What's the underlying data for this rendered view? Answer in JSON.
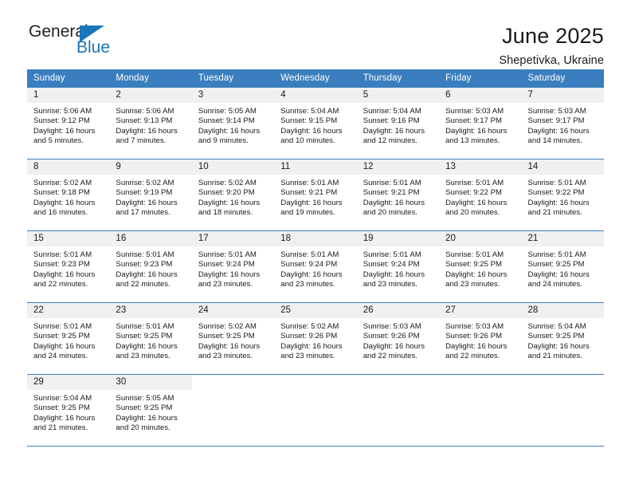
{
  "brand": {
    "name_top": "General",
    "name_bottom": "Blue",
    "accent_color": "#1b75bb"
  },
  "header": {
    "title": "June 2025",
    "subtitle": "Shepetivka, Ukraine"
  },
  "calendar": {
    "header_bg": "#3a7ebf",
    "header_text_color": "#ffffff",
    "daynum_bg": "#f0f0f0",
    "weekdays": [
      "Sunday",
      "Monday",
      "Tuesday",
      "Wednesday",
      "Thursday",
      "Friday",
      "Saturday"
    ],
    "weeks": [
      [
        {
          "day": "1",
          "sunrise": "Sunrise: 5:06 AM",
          "sunset": "Sunset: 9:12 PM",
          "daylight": "Daylight: 16 hours and 5 minutes."
        },
        {
          "day": "2",
          "sunrise": "Sunrise: 5:06 AM",
          "sunset": "Sunset: 9:13 PM",
          "daylight": "Daylight: 16 hours and 7 minutes."
        },
        {
          "day": "3",
          "sunrise": "Sunrise: 5:05 AM",
          "sunset": "Sunset: 9:14 PM",
          "daylight": "Daylight: 16 hours and 9 minutes."
        },
        {
          "day": "4",
          "sunrise": "Sunrise: 5:04 AM",
          "sunset": "Sunset: 9:15 PM",
          "daylight": "Daylight: 16 hours and 10 minutes."
        },
        {
          "day": "5",
          "sunrise": "Sunrise: 5:04 AM",
          "sunset": "Sunset: 9:16 PM",
          "daylight": "Daylight: 16 hours and 12 minutes."
        },
        {
          "day": "6",
          "sunrise": "Sunrise: 5:03 AM",
          "sunset": "Sunset: 9:17 PM",
          "daylight": "Daylight: 16 hours and 13 minutes."
        },
        {
          "day": "7",
          "sunrise": "Sunrise: 5:03 AM",
          "sunset": "Sunset: 9:17 PM",
          "daylight": "Daylight: 16 hours and 14 minutes."
        }
      ],
      [
        {
          "day": "8",
          "sunrise": "Sunrise: 5:02 AM",
          "sunset": "Sunset: 9:18 PM",
          "daylight": "Daylight: 16 hours and 16 minutes."
        },
        {
          "day": "9",
          "sunrise": "Sunrise: 5:02 AM",
          "sunset": "Sunset: 9:19 PM",
          "daylight": "Daylight: 16 hours and 17 minutes."
        },
        {
          "day": "10",
          "sunrise": "Sunrise: 5:02 AM",
          "sunset": "Sunset: 9:20 PM",
          "daylight": "Daylight: 16 hours and 18 minutes."
        },
        {
          "day": "11",
          "sunrise": "Sunrise: 5:01 AM",
          "sunset": "Sunset: 9:21 PM",
          "daylight": "Daylight: 16 hours and 19 minutes."
        },
        {
          "day": "12",
          "sunrise": "Sunrise: 5:01 AM",
          "sunset": "Sunset: 9:21 PM",
          "daylight": "Daylight: 16 hours and 20 minutes."
        },
        {
          "day": "13",
          "sunrise": "Sunrise: 5:01 AM",
          "sunset": "Sunset: 9:22 PM",
          "daylight": "Daylight: 16 hours and 20 minutes."
        },
        {
          "day": "14",
          "sunrise": "Sunrise: 5:01 AM",
          "sunset": "Sunset: 9:22 PM",
          "daylight": "Daylight: 16 hours and 21 minutes."
        }
      ],
      [
        {
          "day": "15",
          "sunrise": "Sunrise: 5:01 AM",
          "sunset": "Sunset: 9:23 PM",
          "daylight": "Daylight: 16 hours and 22 minutes."
        },
        {
          "day": "16",
          "sunrise": "Sunrise: 5:01 AM",
          "sunset": "Sunset: 9:23 PM",
          "daylight": "Daylight: 16 hours and 22 minutes."
        },
        {
          "day": "17",
          "sunrise": "Sunrise: 5:01 AM",
          "sunset": "Sunset: 9:24 PM",
          "daylight": "Daylight: 16 hours and 23 minutes."
        },
        {
          "day": "18",
          "sunrise": "Sunrise: 5:01 AM",
          "sunset": "Sunset: 9:24 PM",
          "daylight": "Daylight: 16 hours and 23 minutes."
        },
        {
          "day": "19",
          "sunrise": "Sunrise: 5:01 AM",
          "sunset": "Sunset: 9:24 PM",
          "daylight": "Daylight: 16 hours and 23 minutes."
        },
        {
          "day": "20",
          "sunrise": "Sunrise: 5:01 AM",
          "sunset": "Sunset: 9:25 PM",
          "daylight": "Daylight: 16 hours and 23 minutes."
        },
        {
          "day": "21",
          "sunrise": "Sunrise: 5:01 AM",
          "sunset": "Sunset: 9:25 PM",
          "daylight": "Daylight: 16 hours and 24 minutes."
        }
      ],
      [
        {
          "day": "22",
          "sunrise": "Sunrise: 5:01 AM",
          "sunset": "Sunset: 9:25 PM",
          "daylight": "Daylight: 16 hours and 24 minutes."
        },
        {
          "day": "23",
          "sunrise": "Sunrise: 5:01 AM",
          "sunset": "Sunset: 9:25 PM",
          "daylight": "Daylight: 16 hours and 23 minutes."
        },
        {
          "day": "24",
          "sunrise": "Sunrise: 5:02 AM",
          "sunset": "Sunset: 9:25 PM",
          "daylight": "Daylight: 16 hours and 23 minutes."
        },
        {
          "day": "25",
          "sunrise": "Sunrise: 5:02 AM",
          "sunset": "Sunset: 9:26 PM",
          "daylight": "Daylight: 16 hours and 23 minutes."
        },
        {
          "day": "26",
          "sunrise": "Sunrise: 5:03 AM",
          "sunset": "Sunset: 9:26 PM",
          "daylight": "Daylight: 16 hours and 22 minutes."
        },
        {
          "day": "27",
          "sunrise": "Sunrise: 5:03 AM",
          "sunset": "Sunset: 9:26 PM",
          "daylight": "Daylight: 16 hours and 22 minutes."
        },
        {
          "day": "28",
          "sunrise": "Sunrise: 5:04 AM",
          "sunset": "Sunset: 9:25 PM",
          "daylight": "Daylight: 16 hours and 21 minutes."
        }
      ],
      [
        {
          "day": "29",
          "sunrise": "Sunrise: 5:04 AM",
          "sunset": "Sunset: 9:25 PM",
          "daylight": "Daylight: 16 hours and 21 minutes."
        },
        {
          "day": "30",
          "sunrise": "Sunrise: 5:05 AM",
          "sunset": "Sunset: 9:25 PM",
          "daylight": "Daylight: 16 hours and 20 minutes."
        },
        {
          "day": "",
          "sunrise": "",
          "sunset": "",
          "daylight": ""
        },
        {
          "day": "",
          "sunrise": "",
          "sunset": "",
          "daylight": ""
        },
        {
          "day": "",
          "sunrise": "",
          "sunset": "",
          "daylight": ""
        },
        {
          "day": "",
          "sunrise": "",
          "sunset": "",
          "daylight": ""
        },
        {
          "day": "",
          "sunrise": "",
          "sunset": "",
          "daylight": ""
        }
      ]
    ]
  }
}
